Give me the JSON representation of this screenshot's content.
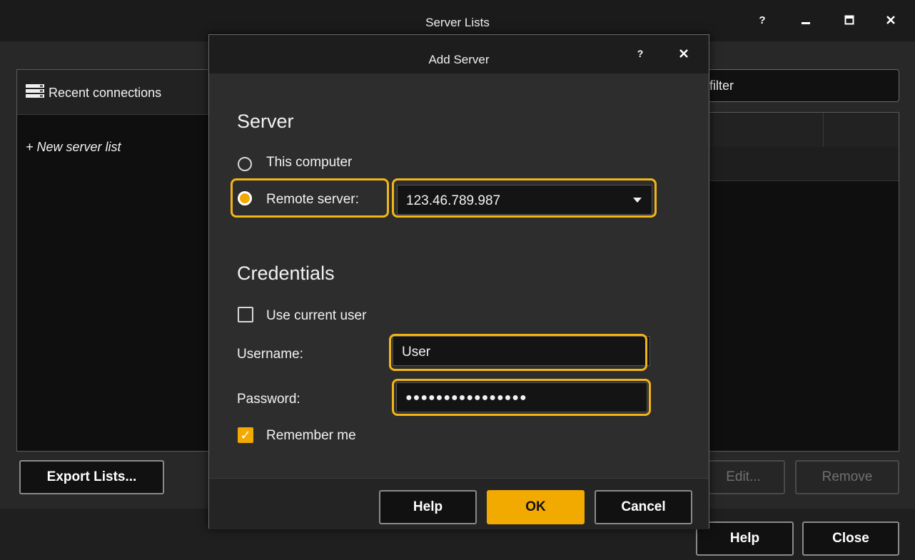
{
  "window": {
    "title": "Server Lists",
    "help": "?",
    "minimize": "▁",
    "maximize": "▭",
    "close": "✕"
  },
  "left_panel": {
    "header_label": "Recent connections",
    "header_icon": "server-list-icon",
    "new_list_label": "+ New server list"
  },
  "right_panel": {
    "filter_text": "filter"
  },
  "bottom_buttons": {
    "export": "Export Lists...",
    "edit": "Edit...",
    "remove": "Remove",
    "help": "Help",
    "close": "Close"
  },
  "dialog": {
    "title": "Add Server",
    "help": "?",
    "close": "✕",
    "server_section": "Server",
    "this_computer_label": "This computer",
    "remote_server_label": "Remote server:",
    "remote_server_value": "123.46.789.987",
    "remote_selected": true,
    "credentials_section": "Credentials",
    "use_current_user_label": "Use current user",
    "use_current_user_checked": false,
    "username_label": "Username:",
    "username_value": "User",
    "password_label": "Password:",
    "password_value": "●●●●●●●●●●●●●●●●",
    "remember_me_label": "Remember me",
    "remember_me_checked": true,
    "help_button": "Help",
    "ok_button": "OK",
    "cancel_button": "Cancel"
  },
  "colors": {
    "accent": "#f2a900",
    "highlight": "#f2b518",
    "background": "#282828"
  }
}
